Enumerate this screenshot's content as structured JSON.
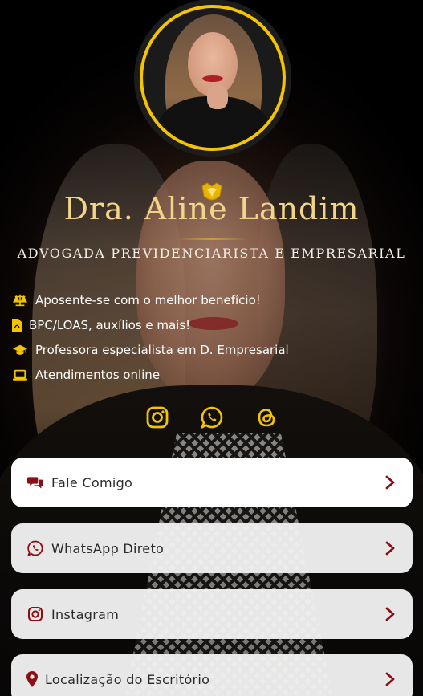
{
  "profile": {
    "name": "Dra. Aline Landim",
    "subtitle": "ADVOGADA PREVIDENCIARISTA E EMPRESARIAL"
  },
  "features": [
    {
      "icon": "scale-icon",
      "text": "Aposente-se com o melhor benefício!"
    },
    {
      "icon": "pdf-file-icon",
      "text": "BPC/LOAS, auxílios e mais!"
    },
    {
      "icon": "graduation-cap-icon",
      "text": "Professora especialista em D. Empresarial"
    },
    {
      "icon": "laptop-icon",
      "text": "Atendimentos online"
    }
  ],
  "socials": [
    {
      "icon": "instagram-icon"
    },
    {
      "icon": "whatsapp-icon"
    },
    {
      "icon": "threads-icon"
    }
  ],
  "buttons": [
    {
      "icon": "comments-icon",
      "label": "Fale Comigo"
    },
    {
      "icon": "whatsapp-icon",
      "label": "WhatsApp Direto"
    },
    {
      "icon": "instagram-icon",
      "label": "Instagram"
    },
    {
      "icon": "map-pin-icon",
      "label": "Localização do Escritório"
    }
  ],
  "colors": {
    "accent_gold": "#f5c400",
    "name_gold": "#f2d58a",
    "icon_red": "#8b0e14",
    "button_bg": "#f0f0f0"
  }
}
